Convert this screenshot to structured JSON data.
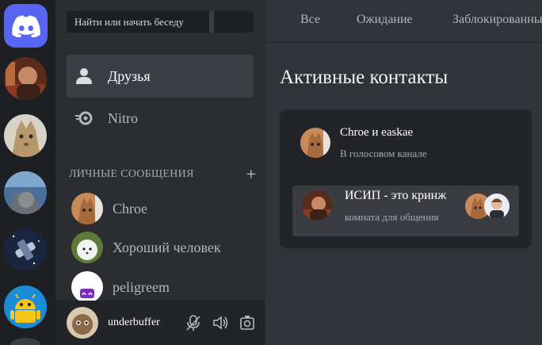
{
  "search": {
    "placeholder": "Найти или начать беседу"
  },
  "nav": [
    {
      "label": "Друзья",
      "icon": "friends-icon"
    },
    {
      "label": "Nitro",
      "icon": "nitro-icon"
    }
  ],
  "dm_section": {
    "header": "ЛИЧНЫЕ СООБЩЕНИЯ",
    "add_symbol": "+",
    "items": [
      {
        "name": "Chroe"
      },
      {
        "name": "Хороший человек"
      },
      {
        "name": "peligreem"
      }
    ]
  },
  "user_panel": {
    "username": "underbuffer"
  },
  "tabs": [
    {
      "label": "Все"
    },
    {
      "label": "Ожидание"
    },
    {
      "label": "Заблокированные"
    }
  ],
  "main": {
    "title": "Активные контакты",
    "activity": {
      "title": "Chroe и easkae",
      "subtitle": "В голосовом канале"
    },
    "voice_channel": {
      "name": "ИСИП - это кринж",
      "description": "комната для общения"
    }
  },
  "colors": {
    "brand": "#5865f2",
    "background": "#313338",
    "sidebar": "#2b2d31",
    "rail": "#1e1f22"
  }
}
